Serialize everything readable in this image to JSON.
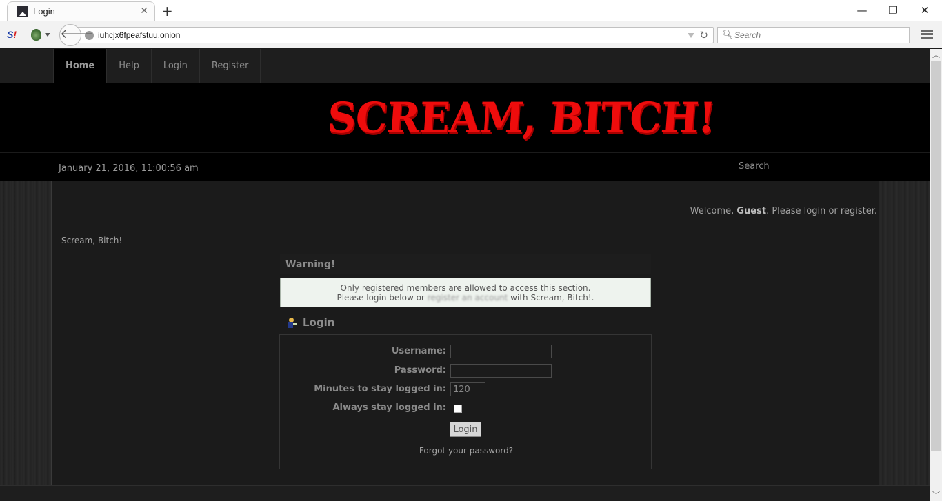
{
  "browser": {
    "tab_title": "Login",
    "url": "iuhcjx6fpeafstuu.onion",
    "search_placeholder": "Search",
    "addon_label": "S!",
    "window_controls": {
      "minimize": "—",
      "restore": "❐",
      "close": "✕"
    }
  },
  "site": {
    "nav": [
      {
        "label": "Home",
        "active": true
      },
      {
        "label": "Help",
        "active": false
      },
      {
        "label": "Login",
        "active": false
      },
      {
        "label": "Register",
        "active": false
      }
    ],
    "logo_text": "SCREAM, BITCH!",
    "logo_color": "#ee0c0c",
    "date": "January 21, 2016, 11:00:56 am",
    "search_placeholder": "Search",
    "welcome": {
      "prefix": "Welcome, ",
      "user": "Guest",
      "middle": ". Please ",
      "login_link": "login",
      "or": " or ",
      "register_link": "register",
      "suffix": "."
    },
    "site_name": "Scream, Bitch!"
  },
  "warning": {
    "title": "Warning!",
    "line1": "Only registered members are allowed to access this section.",
    "line2_prefix": "Please login below or ",
    "line2_link": "register an account",
    "line2_suffix": " with Scream, Bitch!."
  },
  "login": {
    "title": "Login",
    "username_label": "Username:",
    "username_value": "",
    "password_label": "Password:",
    "password_value": "",
    "minutes_label": "Minutes to stay logged in:",
    "minutes_value": "120",
    "always_label": "Always stay logged in:",
    "always_checked": false,
    "submit_label": "Login",
    "forgot_label": "Forgot your password?"
  }
}
